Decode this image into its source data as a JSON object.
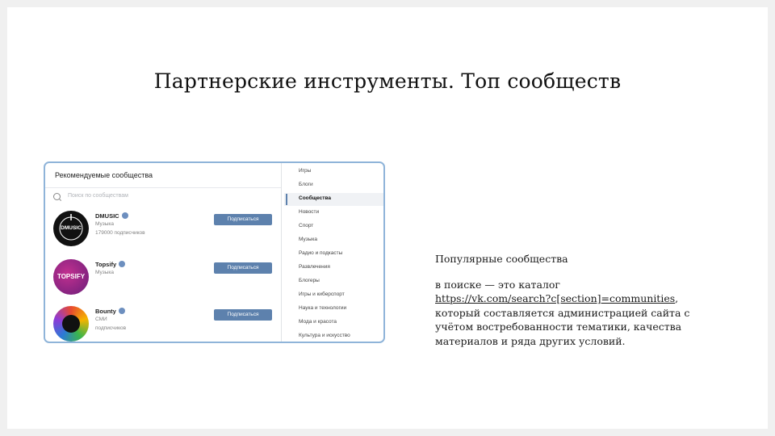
{
  "slide": {
    "title": "Партнерские инструменты. Топ сообществ"
  },
  "screenshot": {
    "header": "Рекомендуемые сообщества",
    "search_placeholder": "Поиск по сообществам",
    "communities": [
      {
        "name": "DMUSIC",
        "category": "Музыка",
        "subscribers": "179000 подписчиков",
        "button": "Подписаться",
        "avatar_text": "DMUSIC",
        "avatar_color": "#111111"
      },
      {
        "name": "Topsify",
        "category": "Музыка",
        "subscribers": "подписчиков",
        "button": "Подписаться",
        "avatar_text": "TOPSIFY",
        "avatar_color": "#a8238a"
      },
      {
        "name": "Bounty",
        "category": "СМИ",
        "subscribers": "подписчиков",
        "button": "Подписаться",
        "avatar_text": "",
        "avatar_color": "#e84a2f"
      }
    ],
    "menu": [
      {
        "label": "Игры",
        "active": false
      },
      {
        "label": "Блоги",
        "active": false
      },
      {
        "label": "Сообщества",
        "active": true
      },
      {
        "label": "Новости",
        "active": false
      },
      {
        "label": "Спорт",
        "active": false
      },
      {
        "label": "Музыка",
        "active": false
      },
      {
        "label": "Радио и подкасты",
        "active": false
      },
      {
        "label": "Развлечения",
        "active": false
      },
      {
        "label": "Блогеры",
        "active": false
      },
      {
        "label": "Игры и киберспорт",
        "active": false
      },
      {
        "label": "Наука и технологии",
        "active": false
      },
      {
        "label": "Мода и красота",
        "active": false
      },
      {
        "label": "Культура и искусство",
        "active": false
      }
    ],
    "accent_color": "#5d81ad"
  },
  "caption": {
    "heading": "Популярные сообщества",
    "line1_prefix": "в поиске — это каталог",
    "link": "https://vk.com/search?c[section]=communities",
    "link_suffix": ",",
    "rest": "который составляется администрацией сайта с учётом востребованности тематики, качества материалов и ряда других условий."
  }
}
